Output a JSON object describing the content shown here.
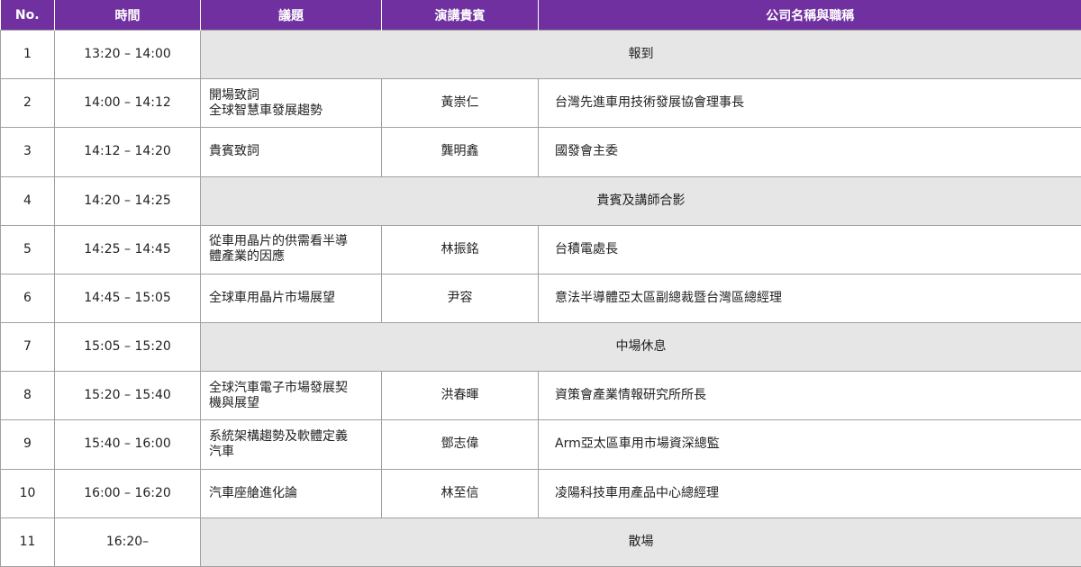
{
  "headers": {
    "no": "No.",
    "time": "時間",
    "topic": "議題",
    "speaker": "演講貴賓",
    "company": "公司名稱與職稱"
  },
  "colors": {
    "header_bg": "#7030a0",
    "span_bg": "#e6e6e6"
  },
  "rows": [
    {
      "no": "1",
      "time": "13:20 – 14:00",
      "span": "報到"
    },
    {
      "no": "2",
      "time": "14:00 – 14:12",
      "topic_lines": [
        "開場致詞",
        "全球智慧車發展趨勢"
      ],
      "speaker": "黃崇仁",
      "company": "台灣先進車用技術發展協會理事長"
    },
    {
      "no": "3",
      "time": "14:12 – 14:20",
      "topic_lines": [
        "貴賓致詞"
      ],
      "speaker": "龔明鑫",
      "company": "國發會主委"
    },
    {
      "no": "4",
      "time": "14:20 – 14:25",
      "span": "貴賓及講師合影"
    },
    {
      "no": "5",
      "time": "14:25 – 14:45",
      "topic_lines": [
        "從車用晶片的供需看半導",
        "體產業的因應"
      ],
      "speaker": "林振銘",
      "company": "台積電處長"
    },
    {
      "no": "6",
      "time": "14:45 – 15:05",
      "topic_lines": [
        "全球車用晶片市場展望"
      ],
      "speaker": "尹容",
      "company": "意法半導體亞太區副總裁暨台灣區總經理"
    },
    {
      "no": "7",
      "time": "15:05 – 15:20",
      "span": "中場休息"
    },
    {
      "no": "8",
      "time": "15:20 – 15:40",
      "topic_lines": [
        "全球汽車電子市場發展契",
        "機與展望"
      ],
      "speaker": "洪春暉",
      "company": "資策會產業情報研究所所長"
    },
    {
      "no": "9",
      "time": "15:40 – 16:00",
      "topic_lines": [
        "系統架構趨勢及軟體定義",
        "汽車"
      ],
      "speaker": "鄧志偉",
      "company": "Arm亞太區車用市場資深總監"
    },
    {
      "no": "10",
      "time": "16:00 – 16:20",
      "topic_lines": [
        "汽車座艙進化論"
      ],
      "speaker": "林至信",
      "company": "凌陽科技車用產品中心總經理"
    },
    {
      "no": "11",
      "time": "16:20–",
      "span": "散場"
    }
  ]
}
